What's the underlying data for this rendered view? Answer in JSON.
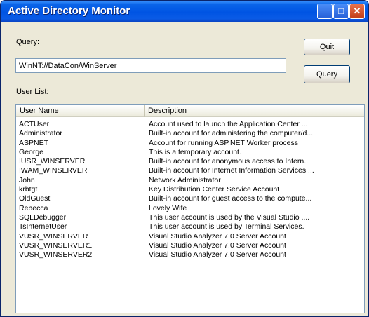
{
  "window": {
    "title": "Active Directory Monitor",
    "minimize_glyph": "_",
    "maximize_glyph": "□",
    "close_glyph": "✕"
  },
  "form": {
    "query_label": "Query:",
    "query_value": "WinNT://DataCon/WinServer",
    "quit_button": "Quit",
    "query_button": "Query",
    "user_list_label": "User List:"
  },
  "list": {
    "columns": [
      "User Name",
      "Description"
    ],
    "rows": [
      {
        "name": "ACTUser",
        "description": "Account used to launch the Application Center ..."
      },
      {
        "name": "Administrator",
        "description": "Built-in account for administering the computer/d..."
      },
      {
        "name": "ASPNET",
        "description": "Account for running ASP.NET Worker process"
      },
      {
        "name": "George",
        "description": "This is a temporary account."
      },
      {
        "name": "IUSR_WINSERVER",
        "description": "Built-in account for anonymous access to Intern..."
      },
      {
        "name": "IWAM_WINSERVER",
        "description": "Built-in account for Internet Information Services ..."
      },
      {
        "name": "John",
        "description": "Network Administrator"
      },
      {
        "name": "krbtgt",
        "description": "Key Distribution Center Service Account"
      },
      {
        "name": "OldGuest",
        "description": "Built-in account for guest access to the compute..."
      },
      {
        "name": "Rebecca",
        "description": "Lovely Wife"
      },
      {
        "name": "SQLDebugger",
        "description": "This user account is used by the Visual Studio ...."
      },
      {
        "name": "TsInternetUser",
        "description": "This user account is used by Terminal Services."
      },
      {
        "name": "VUSR_WINSERVER",
        "description": "Visual Studio Analyzer 7.0 Server Account"
      },
      {
        "name": "VUSR_WINSERVER1",
        "description": "Visual Studio Analyzer 7.0 Server Account"
      },
      {
        "name": "VUSR_WINSERVER2",
        "description": "Visual Studio Analyzer 7.0 Server Account"
      }
    ]
  },
  "colors": {
    "titlebar": "#0054e3",
    "window_bg": "#ece9d8",
    "close_button": "#c13e18"
  }
}
